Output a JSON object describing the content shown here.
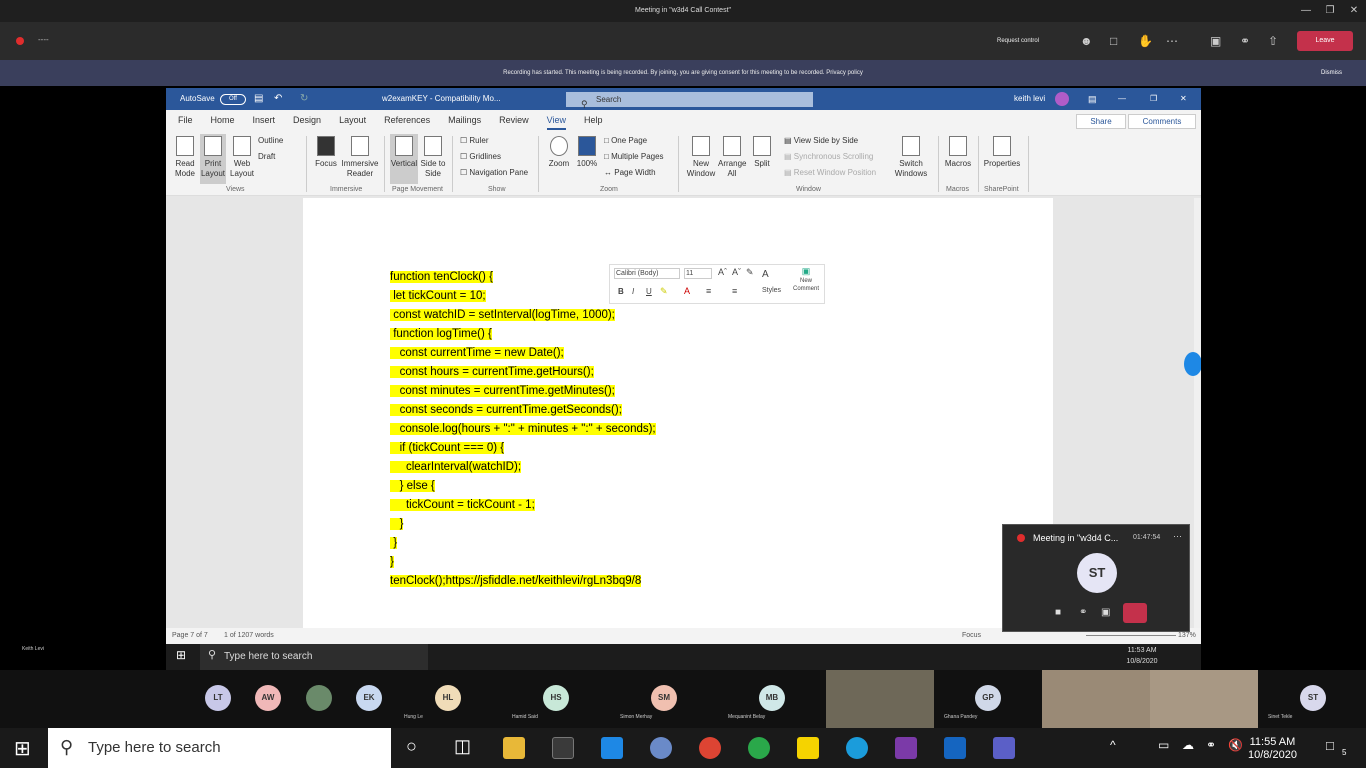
{
  "teams": {
    "window_title": "Meeting in \"w3d4 Call Contest\"",
    "meeting_label": "----",
    "request_control": "Request control",
    "leave": "Leave",
    "banner": "Recording has started.   This meeting is being recorded. By joining, you are giving consent for this meeting to be recorded. Privacy policy",
    "dismiss": "Dismiss",
    "local_user": "Keith Levi"
  },
  "word": {
    "autosave_label": "AutoSave",
    "autosave_state": "Off",
    "doc_title": "w2examKEY - Compatibility Mo...",
    "search_placeholder": "Search",
    "user": "keith levi",
    "menu": [
      "File",
      "Home",
      "Insert",
      "Design",
      "Layout",
      "References",
      "Mailings",
      "Review",
      "View",
      "Help"
    ],
    "active_menu": "View",
    "share": "Share",
    "comments": "Comments",
    "ribbon": {
      "read_mode": "Read Mode",
      "print_layout": "Print Layout",
      "web_layout": "Web Layout",
      "outline": "Outline",
      "draft": "Draft",
      "views_group": "Views",
      "focus": "Focus",
      "immersive_reader": "Immersive Reader",
      "immersive_group": "Immersive",
      "vertical": "Vertical",
      "side_to_side": "Side to Side",
      "page_movement_group": "Page Movement",
      "ruler": "Ruler",
      "gridlines": "Gridlines",
      "navigation_pane": "Navigation Pane",
      "show_group": "Show",
      "zoom": "Zoom",
      "hundred": "100%",
      "one_page": "One Page",
      "multiple_pages": "Multiple Pages",
      "page_width": "Page Width",
      "zoom_group": "Zoom",
      "new_window": "New Window",
      "arrange_all": "Arrange All",
      "split": "Split",
      "view_side_by_side": "View Side by Side",
      "sync_scrolling": "Synchronous Scrolling",
      "reset_window": "Reset Window Position",
      "switch_windows": "Switch Windows",
      "window_group": "Window",
      "macros": "Macros",
      "macros_group": "Macros",
      "properties": "Properties",
      "sharepoint_group": "SharePoint"
    },
    "mini_toolbar": {
      "font": "Calibri (Body)",
      "size": "11",
      "styles": "Styles",
      "new_comment": "New Comment"
    },
    "code_lines": [
      "function tenClock() {",
      " let tickCount = 10;",
      " const watchID = setInterval(logTime, 1000);",
      "",
      " function logTime() {",
      "   const currentTime = new Date();",
      "   const hours = currentTime.getHours();",
      "   const minutes = currentTime.getMinutes();",
      "   const seconds = currentTime.getSeconds();",
      "   console.log(hours + \":\" + minutes + \":\" + seconds);",
      "   if (tickCount === 0) {",
      "     clearInterval(watchID);",
      "   } else {",
      "     tickCount = tickCount - 1;",
      "   }",
      " }",
      "}",
      "tenClock();https://jsfiddle.net/keithlevi/rgLn3bq9/8"
    ],
    "status": {
      "page": "Page 7 of 7",
      "words": "1 of 1207 words",
      "focus": "Focus",
      "zoom": "137%"
    }
  },
  "meeting_popup": {
    "title": "Meeting in \"w3d4 C...",
    "timer": "01:47:54",
    "initials": "ST"
  },
  "inner_taskbar": {
    "search": "Type here to search",
    "time": "11:53 AM",
    "date": "10/8/2020"
  },
  "participants": [
    {
      "initials": "LT",
      "name": "",
      "color": "#c8c8e8"
    },
    {
      "initials": "AW",
      "name": "",
      "color": "#f0b8b8"
    },
    {
      "initials": "EK",
      "name": "",
      "color": "#c8d8f0"
    },
    {
      "initials": "HL",
      "name": "Hung Le",
      "color": "#f0dcb8"
    },
    {
      "initials": "HS",
      "name": "Hamid Said",
      "color": "#c8e8d8"
    },
    {
      "initials": "SM",
      "name": "Simon Merhay",
      "color": "#f0c0b0"
    },
    {
      "initials": "MB",
      "name": "Mequanint Belay",
      "color": "#d0e8e8"
    },
    {
      "initials": "GP",
      "name": "Ghana Pandey",
      "color": "#d0d8e8"
    },
    {
      "initials": "ST",
      "name": "Sinet Tekle",
      "color": "#d8d8ec"
    }
  ],
  "taskbar": {
    "search": "Type here to search",
    "time": "11:55 AM",
    "date": "10/8/2020",
    "notifications": "5"
  }
}
